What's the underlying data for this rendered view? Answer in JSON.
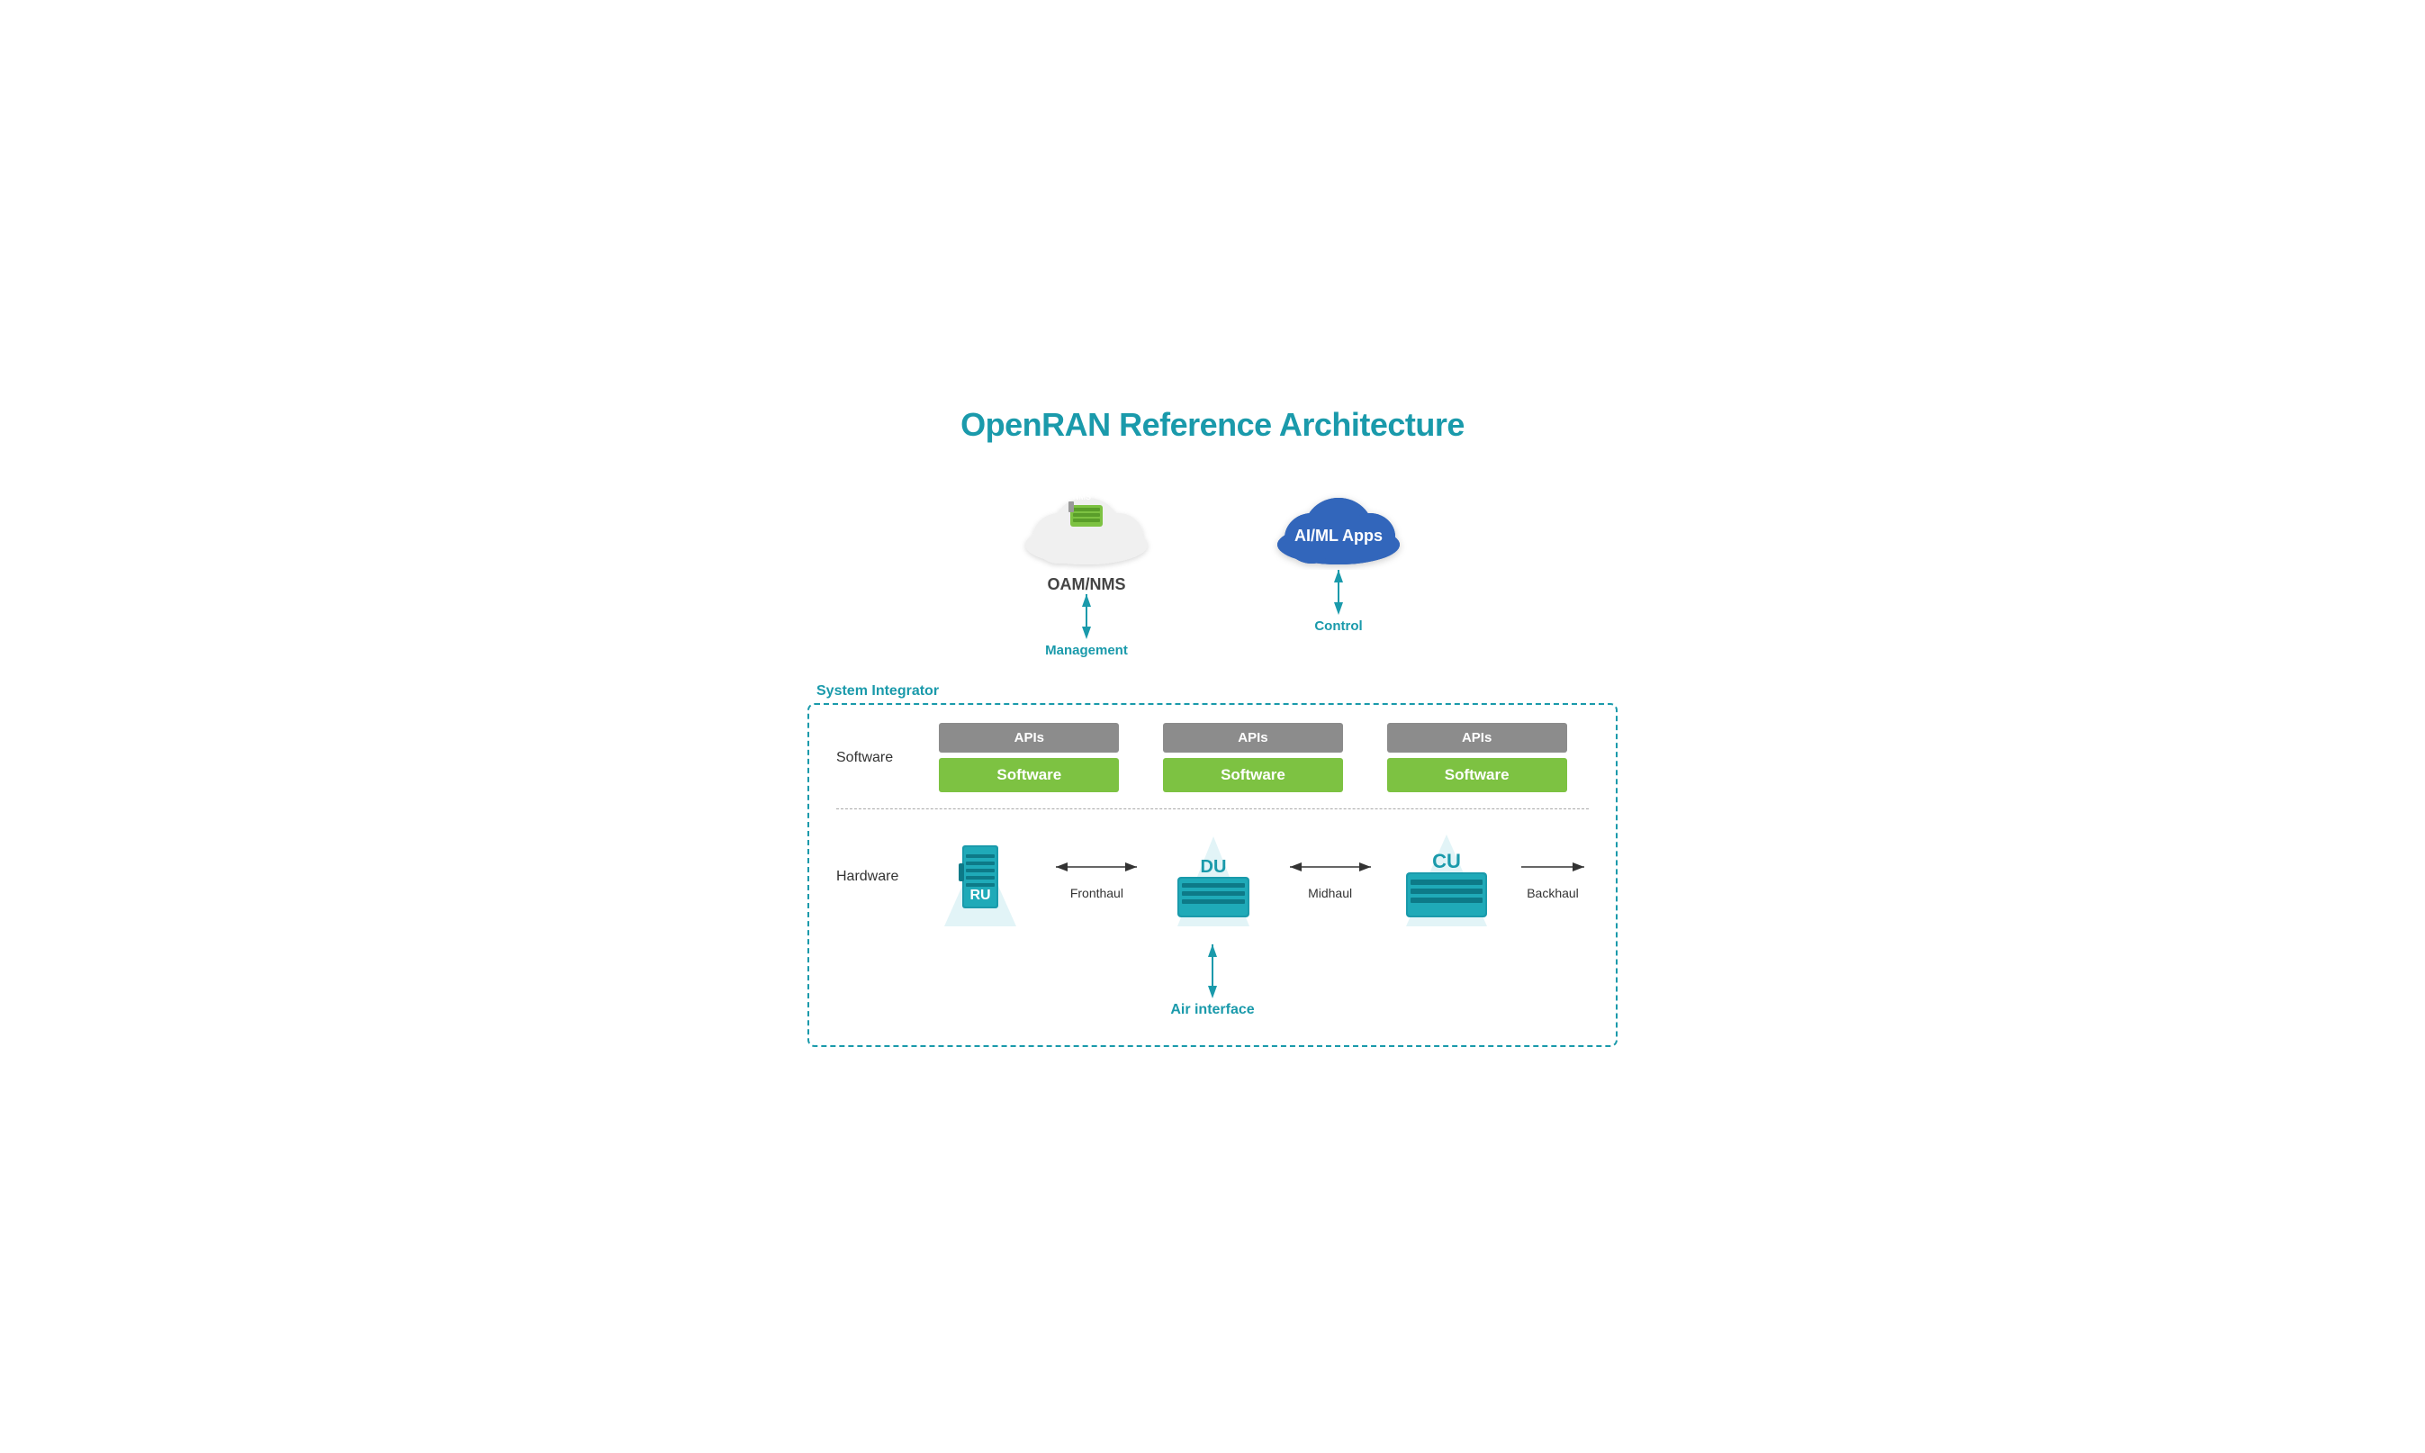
{
  "title": "OpenRAN Reference Architecture",
  "clouds": {
    "oam": {
      "label": "OAM/NMS",
      "type": "white",
      "arrow_label": "Management"
    },
    "aiml": {
      "label": "AI/ML Apps",
      "type": "blue",
      "arrow_label": "Control"
    }
  },
  "system_integrator": {
    "label": "System Integrator",
    "software_label": "Software",
    "hardware_label": "Hardware",
    "cards": [
      {
        "api": "APIs",
        "software": "Software"
      },
      {
        "api": "APIs",
        "software": "Software"
      },
      {
        "api": "APIs",
        "software": "Software"
      }
    ],
    "devices": [
      {
        "name": "RU",
        "label": "RU"
      },
      {
        "name": "DU",
        "label": "DU"
      },
      {
        "name": "CU",
        "label": "CU"
      }
    ],
    "connections": [
      {
        "label": "Fronthaul"
      },
      {
        "label": "Midhaul"
      }
    ],
    "backhaul": "Backhaul",
    "air_interface": "Air interface"
  }
}
